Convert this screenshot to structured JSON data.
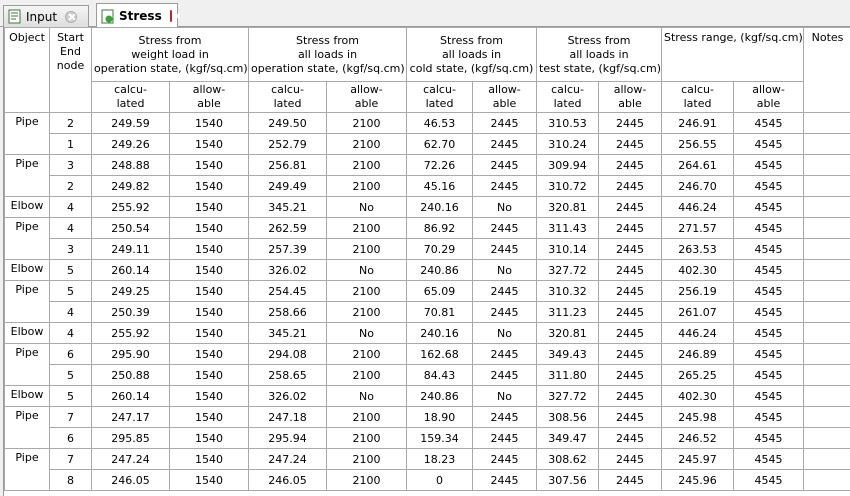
{
  "tabs": [
    {
      "label": "Input",
      "active": false
    },
    {
      "label": "Stress",
      "active": true
    }
  ],
  "headers": {
    "object": "Object",
    "node": [
      "Start",
      "End",
      "node"
    ],
    "groups": [
      [
        "Stress from",
        "weight load in",
        "operation state, (kgf/sq.cm)"
      ],
      [
        "Stress from",
        "all loads in",
        "operation state, (kgf/sq.cm)"
      ],
      [
        "Stress from",
        "all loads in",
        "cold state, (kgf/sq.cm)"
      ],
      [
        "Stress from",
        "all loads in",
        "test state, (kgf/sq.cm)"
      ],
      [
        "Stress range, (kgf/sq.cm)"
      ]
    ],
    "notes": "Notes",
    "calculated": [
      "calcu-",
      "lated"
    ],
    "allowable": [
      "allow-",
      "able"
    ]
  },
  "rows": [
    {
      "object": "Pipe",
      "span": 2,
      "node": "2",
      "v": [
        "249.59",
        "1540",
        "249.50",
        "2100",
        "46.53",
        "2445",
        "310.53",
        "2445",
        "246.91",
        "4545"
      ]
    },
    {
      "node": "1",
      "v": [
        "249.26",
        "1540",
        "252.79",
        "2100",
        "62.70",
        "2445",
        "310.24",
        "2445",
        "256.55",
        "4545"
      ]
    },
    {
      "object": "Pipe",
      "span": 2,
      "node": "3",
      "v": [
        "248.88",
        "1540",
        "256.81",
        "2100",
        "72.26",
        "2445",
        "309.94",
        "2445",
        "264.61",
        "4545"
      ]
    },
    {
      "node": "2",
      "v": [
        "249.82",
        "1540",
        "249.49",
        "2100",
        "45.16",
        "2445",
        "310.72",
        "2445",
        "246.70",
        "4545"
      ]
    },
    {
      "object": "Elbow",
      "span": 1,
      "node": "4",
      "v": [
        "255.92",
        "1540",
        "345.21",
        "No",
        "240.16",
        "No",
        "320.81",
        "2445",
        "446.24",
        "4545"
      ]
    },
    {
      "object": "Pipe",
      "span": 2,
      "node": "4",
      "v": [
        "250.54",
        "1540",
        "262.59",
        "2100",
        "86.92",
        "2445",
        "311.43",
        "2445",
        "271.57",
        "4545"
      ]
    },
    {
      "node": "3",
      "v": [
        "249.11",
        "1540",
        "257.39",
        "2100",
        "70.29",
        "2445",
        "310.14",
        "2445",
        "263.53",
        "4545"
      ]
    },
    {
      "object": "Elbow",
      "span": 1,
      "node": "5",
      "v": [
        "260.14",
        "1540",
        "326.02",
        "No",
        "240.86",
        "No",
        "327.72",
        "2445",
        "402.30",
        "4545"
      ]
    },
    {
      "object": "Pipe",
      "span": 2,
      "node": "5",
      "v": [
        "249.25",
        "1540",
        "254.45",
        "2100",
        "65.09",
        "2445",
        "310.32",
        "2445",
        "256.19",
        "4545"
      ]
    },
    {
      "node": "4",
      "v": [
        "250.39",
        "1540",
        "258.66",
        "2100",
        "70.81",
        "2445",
        "311.23",
        "2445",
        "261.07",
        "4545"
      ]
    },
    {
      "object": "Elbow",
      "span": 1,
      "node": "4",
      "v": [
        "255.92",
        "1540",
        "345.21",
        "No",
        "240.16",
        "No",
        "320.81",
        "2445",
        "446.24",
        "4545"
      ]
    },
    {
      "object": "Pipe",
      "span": 2,
      "node": "6",
      "v": [
        "295.90",
        "1540",
        "294.08",
        "2100",
        "162.68",
        "2445",
        "349.43",
        "2445",
        "246.89",
        "4545"
      ]
    },
    {
      "node": "5",
      "v": [
        "250.88",
        "1540",
        "258.65",
        "2100",
        "84.43",
        "2445",
        "311.80",
        "2445",
        "265.25",
        "4545"
      ]
    },
    {
      "object": "Elbow",
      "span": 1,
      "node": "5",
      "v": [
        "260.14",
        "1540",
        "326.02",
        "No",
        "240.86",
        "No",
        "327.72",
        "2445",
        "402.30",
        "4545"
      ]
    },
    {
      "object": "Pipe",
      "span": 2,
      "node": "7",
      "v": [
        "247.17",
        "1540",
        "247.18",
        "2100",
        "18.90",
        "2445",
        "308.56",
        "2445",
        "245.98",
        "4545"
      ]
    },
    {
      "node": "6",
      "v": [
        "295.85",
        "1540",
        "295.94",
        "2100",
        "159.34",
        "2445",
        "349.47",
        "2445",
        "246.52",
        "4545"
      ]
    },
    {
      "object": "Pipe",
      "span": 2,
      "node": "7",
      "v": [
        "247.24",
        "1540",
        "247.24",
        "2100",
        "18.23",
        "2445",
        "308.62",
        "2445",
        "245.97",
        "4545"
      ]
    },
    {
      "node": "8",
      "v": [
        "246.05",
        "1540",
        "246.05",
        "2100",
        "0",
        "2445",
        "307.56",
        "2445",
        "245.96",
        "4545"
      ]
    }
  ]
}
